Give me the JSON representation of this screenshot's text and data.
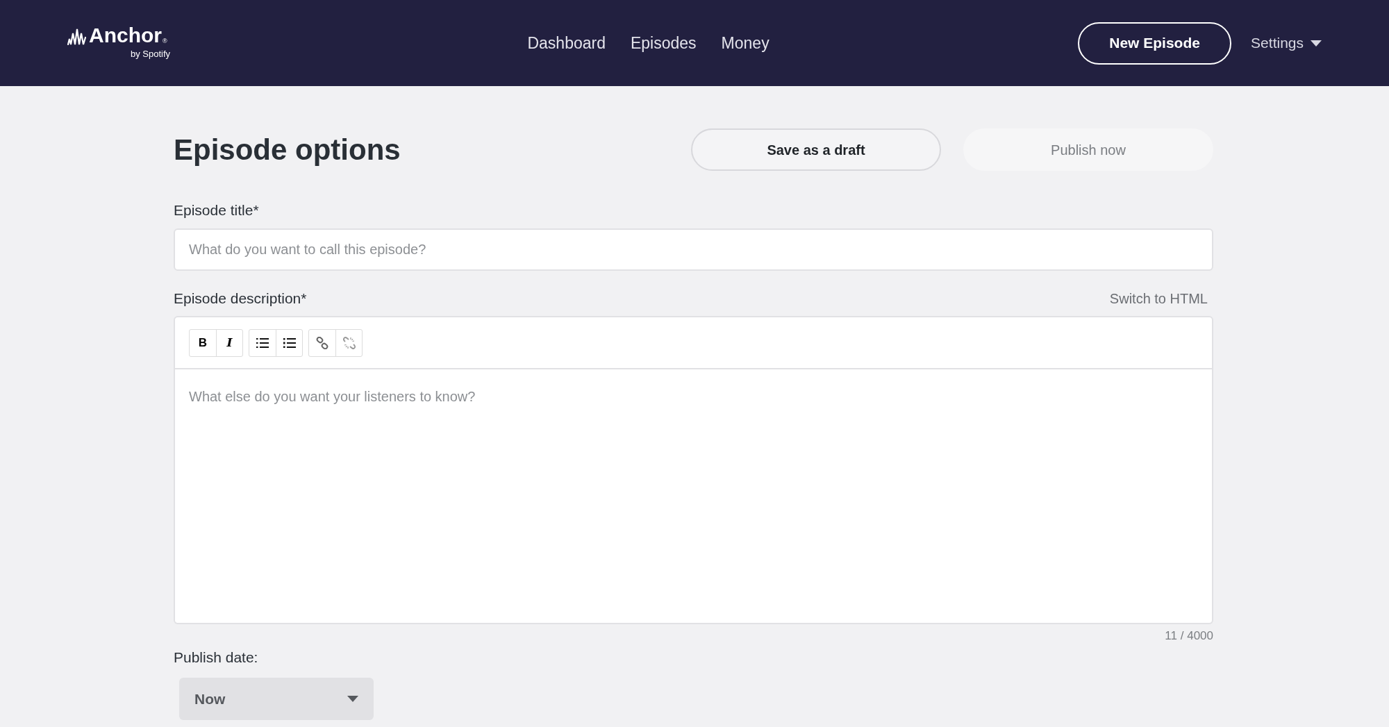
{
  "header": {
    "logo": {
      "name": "Anchor",
      "mark": "®",
      "tagline": "by Spotify"
    },
    "nav": [
      {
        "label": "Dashboard"
      },
      {
        "label": "Episodes"
      },
      {
        "label": "Money"
      }
    ],
    "new_episode_button": "New Episode",
    "settings": {
      "label": "Settings"
    }
  },
  "page": {
    "title": "Episode options",
    "actions": [
      {
        "label": "Save as a draft",
        "disabled": false
      },
      {
        "label": "Publish now",
        "disabled": true
      }
    ],
    "episode_title": {
      "label": "Episode title*",
      "placeholder": "What do you want to call this episode?"
    },
    "episode_description": {
      "label": "Episode description*",
      "switch_link": "Switch to HTML",
      "toolbar": [
        [
          {
            "kind": "bold",
            "label": "B"
          },
          {
            "kind": "italic",
            "label": "I"
          }
        ],
        [
          {
            "kind": "bullet-list"
          },
          {
            "kind": "numbered-list"
          }
        ],
        [
          {
            "kind": "link"
          },
          {
            "kind": "unlink"
          }
        ]
      ],
      "placeholder": "What else do you want your listeners to know?",
      "counter": "11 / 4000"
    },
    "publish_date": {
      "label": "Publish date:",
      "value": "Now"
    }
  }
}
